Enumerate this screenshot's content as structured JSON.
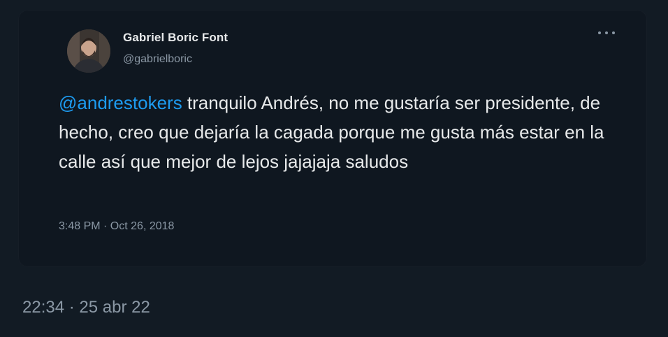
{
  "tweet": {
    "author_name": "Gabriel Boric Font",
    "author_handle": "@gabrielboric",
    "mention": "@andrestokers",
    "body": " tranquilo Andrés, no me gustaría ser presidente, de hecho, creo que dejaría la cagada porque me gusta más estar en la calle así que mejor de lejos jajajaja saludos",
    "timestamp": "3:48 PM · Oct 26, 2018",
    "more_icon": "more-horizontal-icon"
  },
  "share": {
    "timestamp": "22:34 · 25 abr 22"
  },
  "colors": {
    "background": "#121b24",
    "card": "#0f1720",
    "text": "#e7e9ea",
    "muted": "#8b98a5",
    "link": "#1d9bf0"
  }
}
